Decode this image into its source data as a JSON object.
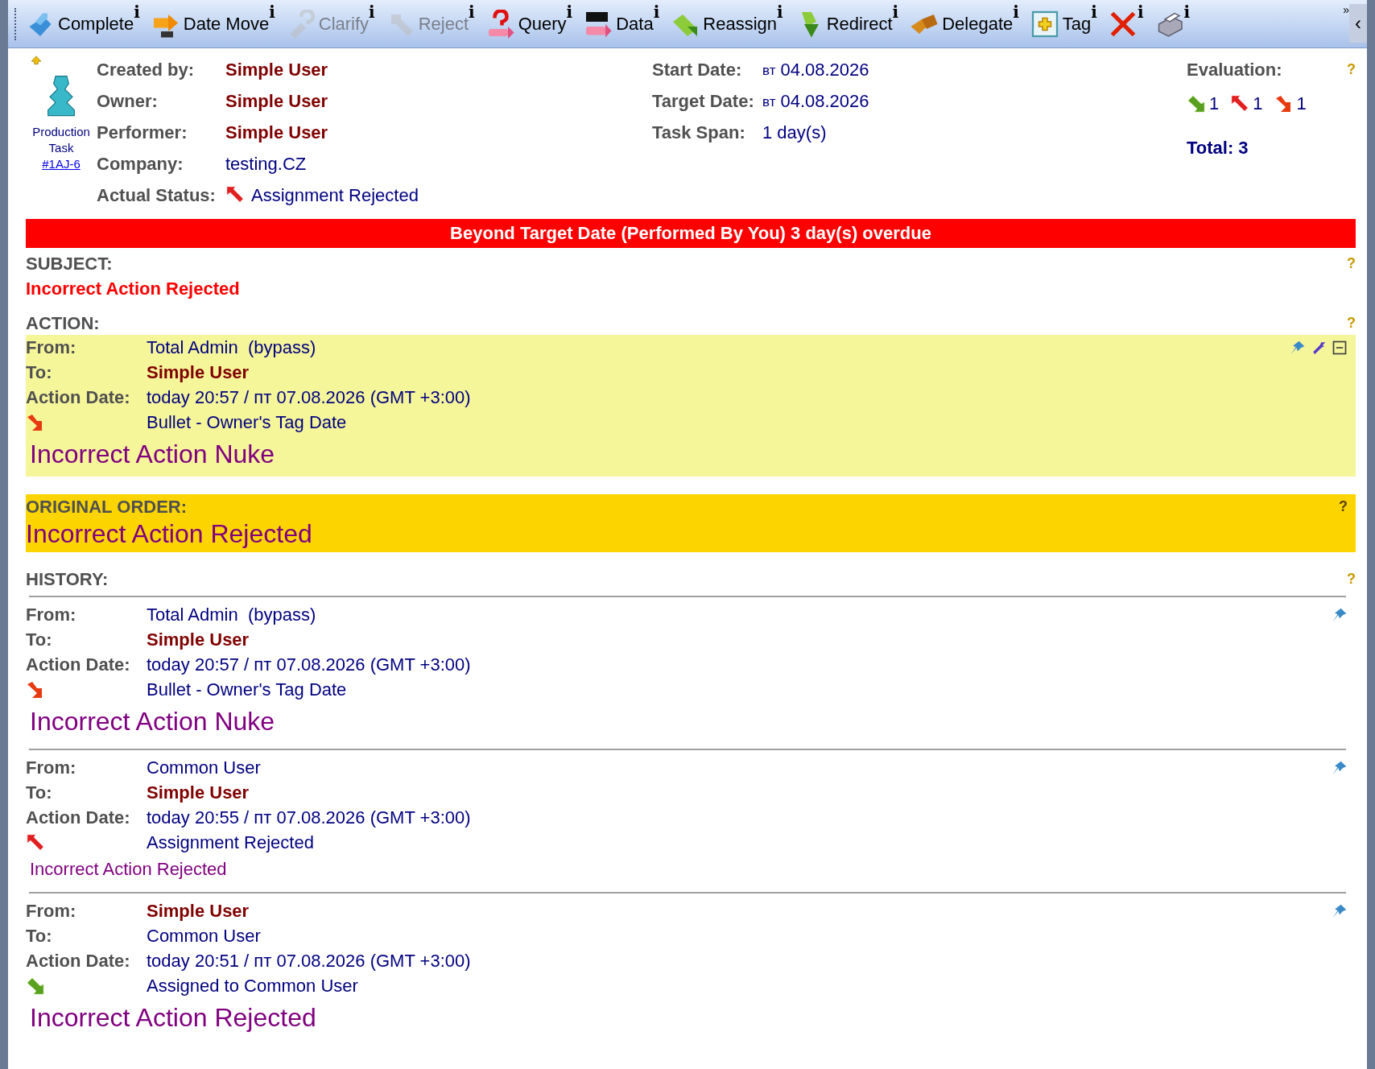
{
  "toolbar": {
    "items": [
      {
        "kind": "complete",
        "label": "Complete",
        "info": "i",
        "disabled": false
      },
      {
        "kind": "date-move",
        "label": "Date Move",
        "info": "i",
        "disabled": false
      },
      {
        "kind": "clarify",
        "label": "Clarify",
        "info": "i",
        "disabled": true
      },
      {
        "kind": "reject",
        "label": "Reject",
        "info": "i",
        "disabled": true
      },
      {
        "kind": "query",
        "label": "Query",
        "info": "i",
        "disabled": false
      },
      {
        "kind": "data",
        "label": "Data",
        "info": "i",
        "disabled": false
      },
      {
        "kind": "reassign",
        "label": "Reassign",
        "info": "i",
        "disabled": false
      },
      {
        "kind": "redirect",
        "label": "Redirect",
        "info": "i",
        "disabled": false
      },
      {
        "kind": "delegate",
        "label": "Delegate",
        "info": "i",
        "disabled": false
      },
      {
        "kind": "tag",
        "label": "Tag",
        "info": "i",
        "disabled": false
      },
      {
        "kind": "delete",
        "info": "i",
        "disabled": false
      },
      {
        "kind": "print",
        "info": "i",
        "disabled": false
      }
    ],
    "overflow": "»",
    "collapse": "‹"
  },
  "task": {
    "type": "Production Task",
    "id": "#1AJ-6"
  },
  "details": [
    {
      "label": "Created by:",
      "value": "Simple User",
      "highlight": true
    },
    {
      "label": "Owner:",
      "value": "Simple User",
      "highlight": true
    },
    {
      "label": "Performer:",
      "value": "Simple User",
      "highlight": true
    },
    {
      "label": "Company:",
      "value": "testing.CZ",
      "highlight": false
    },
    {
      "label": "Actual Status:",
      "value": "Assignment Rejected",
      "highlight": false,
      "kind": "rejected"
    }
  ],
  "dates": [
    {
      "label": "Start Date:",
      "prefix": "вт",
      "value": "04.08.2026"
    },
    {
      "label": "Target Date:",
      "prefix": "вт",
      "value": "04.08.2026"
    },
    {
      "label": "Task Span:",
      "value": "1 day(s)"
    }
  ],
  "evaluation": {
    "label": "Evaluation:",
    "help": "?",
    "counts": [
      {
        "kind": "assigned",
        "value": "1"
      },
      {
        "kind": "rejected",
        "value": "1"
      },
      {
        "kind": "bullet",
        "value": "1"
      }
    ],
    "total": "Total: 3"
  },
  "overdue_banner": "Beyond Target Date (Performed By You) 3 day(s) overdue",
  "subject": {
    "label": "SUBJECT:",
    "help": "?",
    "text": "Incorrect Action Rejected"
  },
  "action": {
    "label": "ACTION:",
    "help": "?",
    "from_label": "From:",
    "from": "Total Admin  (bypass)",
    "from_highlight": false,
    "to_label": "To:",
    "to": "Simple User",
    "to_highlight": true,
    "date_label": "Action Date:",
    "date": "today 20:57 / пт 07.08.2026 (GMT +3:00)",
    "kind": "bullet",
    "status_text": "Bullet - Owner's Tag Date",
    "message": "Incorrect Action Nuke",
    "large": true
  },
  "original_order": {
    "label": "ORIGINAL ORDER:",
    "help": "?",
    "text": "Incorrect Action Rejected"
  },
  "history": {
    "label": "HISTORY:",
    "help": "?",
    "entries": [
      {
        "from_label": "From:",
        "from": "Total Admin  (bypass)",
        "from_highlight": false,
        "to_label": "To:",
        "to": "Simple User",
        "to_highlight": true,
        "date_label": "Action Date:",
        "date": "today 20:57 / пт 07.08.2026 (GMT +3:00)",
        "kind": "bullet",
        "status_text": "Bullet - Owner's Tag Date",
        "message": "Incorrect Action Nuke",
        "large": true
      },
      {
        "from_label": "From:",
        "from": "Common User",
        "from_highlight": false,
        "to_label": "To:",
        "to": "Simple User",
        "to_highlight": true,
        "date_label": "Action Date:",
        "date": "today 20:55 / пт 07.08.2026 (GMT +3:00)",
        "kind": "rejected",
        "status_text": "Assignment Rejected",
        "message": "Incorrect Action Rejected",
        "large": false
      },
      {
        "from_label": "From:",
        "from": "Simple User",
        "from_highlight": true,
        "to_label": "To:",
        "to": "Common User",
        "to_highlight": false,
        "date_label": "Action Date:",
        "date": "today 20:51 / пт 07.08.2026 (GMT +3:00)",
        "kind": "assigned",
        "status_text": "Assigned to Common User",
        "message": "Incorrect Action Rejected",
        "large": true
      }
    ]
  }
}
